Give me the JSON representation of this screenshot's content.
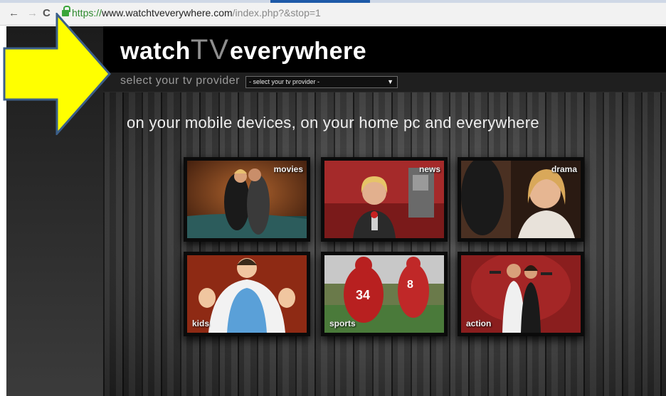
{
  "browser": {
    "back_glyph": "←",
    "forward_glyph": "→",
    "reload_glyph": "C",
    "url_scheme": "https://",
    "url_host": "www.watchtveverywhere.com",
    "url_path": "/index.php?&stop=1"
  },
  "site": {
    "logo_part1": "watch",
    "logo_part2": "TV",
    "logo_part3": "everywhere",
    "provider_label": "select your tv provider",
    "provider_select_value": "- select your tv provider -",
    "tagline": "on your mobile devices, on your home pc and everywhere"
  },
  "tiles": [
    {
      "label": "movies"
    },
    {
      "label": "news"
    },
    {
      "label": "drama"
    },
    {
      "label": "kids"
    },
    {
      "label": "sports"
    },
    {
      "label": "action"
    }
  ],
  "colors": {
    "arrow_fill": "#ffff00",
    "arrow_stroke": "#3b5f8a",
    "secure_green": "#2d8a2d"
  }
}
